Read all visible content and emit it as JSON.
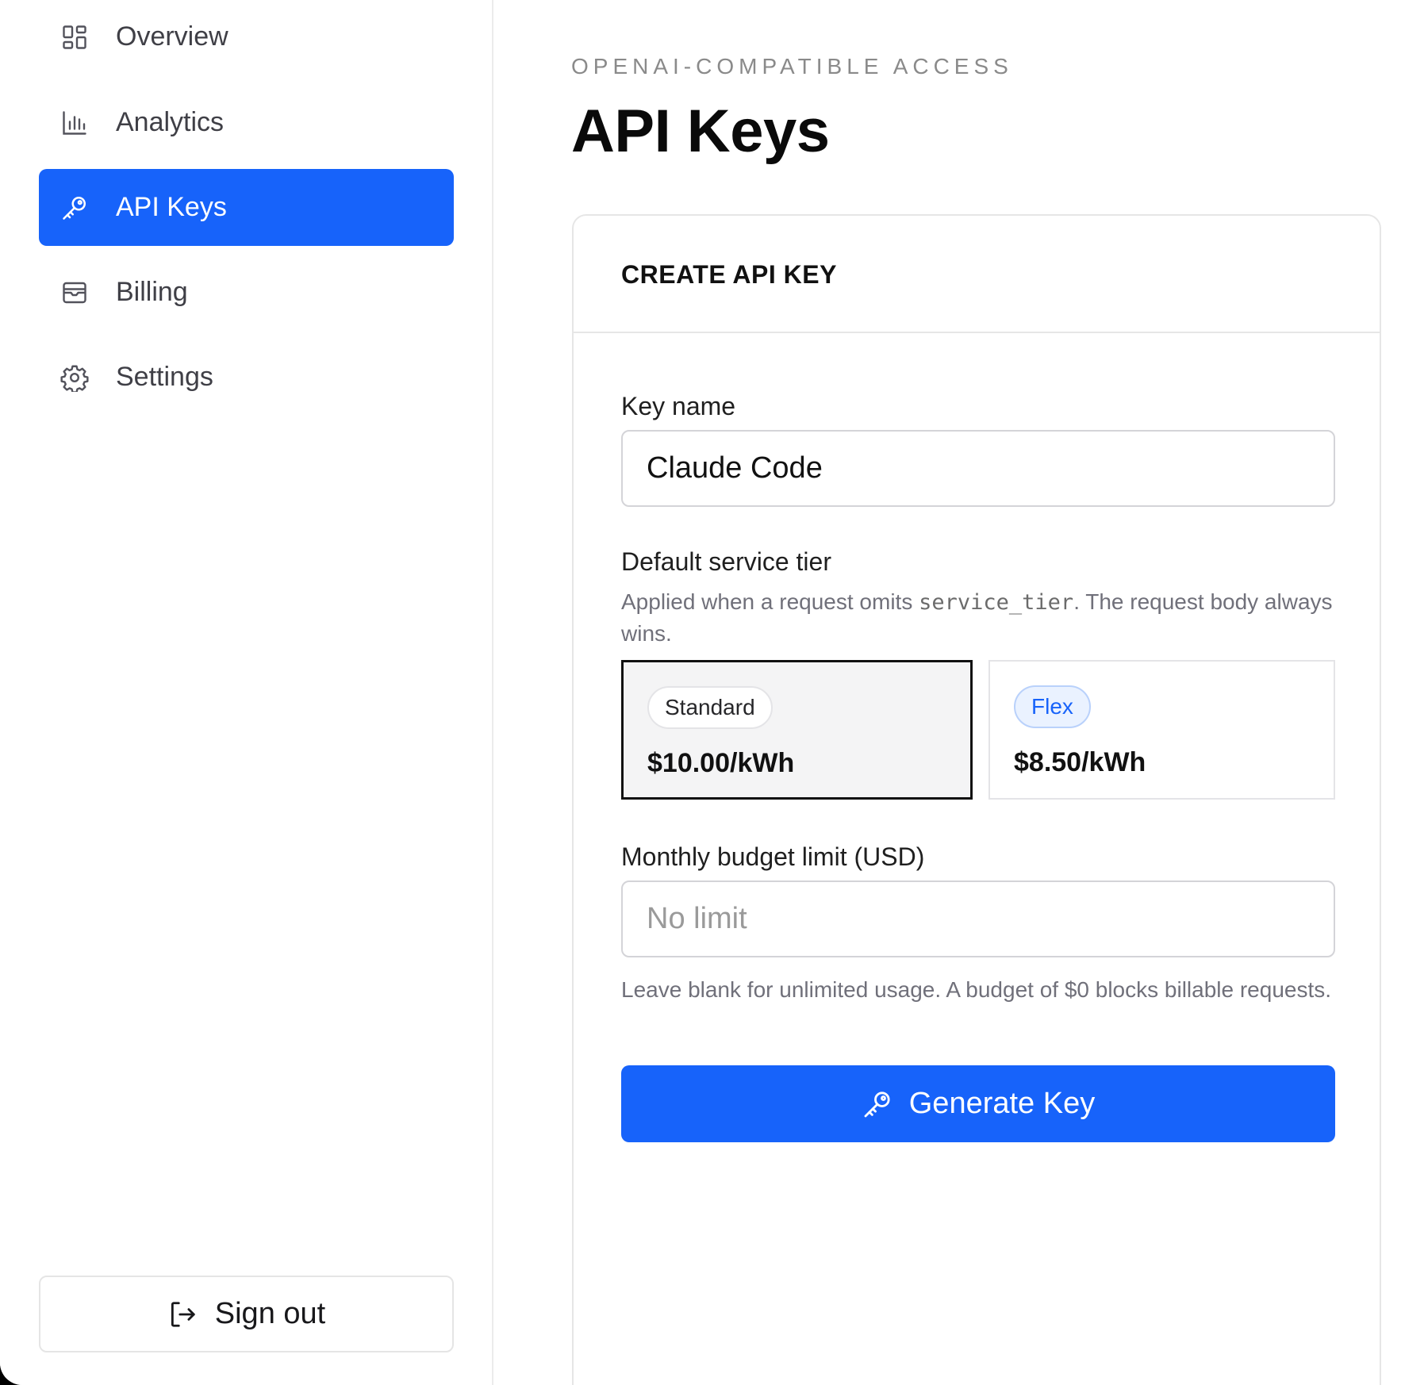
{
  "sidebar": {
    "items": [
      {
        "label": "Overview",
        "icon": "dashboard-grid-icon",
        "active": false
      },
      {
        "label": "Analytics",
        "icon": "bar-chart-icon",
        "active": false
      },
      {
        "label": "API Keys",
        "icon": "key-icon",
        "active": true
      },
      {
        "label": "Billing",
        "icon": "billing-icon",
        "active": false
      },
      {
        "label": "Settings",
        "icon": "gear-icon",
        "active": false
      }
    ],
    "signout_label": "Sign out"
  },
  "header": {
    "eyebrow": "OPENAI-COMPATIBLE ACCESS",
    "title": "API Keys"
  },
  "form": {
    "card_title": "CREATE API KEY",
    "key_name": {
      "label": "Key name",
      "value": "Claude Code"
    },
    "service_tier": {
      "label": "Default service tier",
      "help_prefix": "Applied when a request omits ",
      "help_code": "service_tier",
      "help_suffix": ". The request body always wins.",
      "options": [
        {
          "name": "Standard",
          "price": "$10.00/kWh",
          "selected": true
        },
        {
          "name": "Flex",
          "price": "$8.50/kWh",
          "selected": false
        }
      ]
    },
    "budget": {
      "label": "Monthly budget limit (USD)",
      "placeholder": "No limit",
      "value": "",
      "help": "Leave blank for unlimited usage. A budget of $0 blocks billable requests."
    },
    "submit_label": "Generate Key"
  },
  "colors": {
    "accent": "#1763fa",
    "flex_badge_bg": "#eaf2ff"
  }
}
